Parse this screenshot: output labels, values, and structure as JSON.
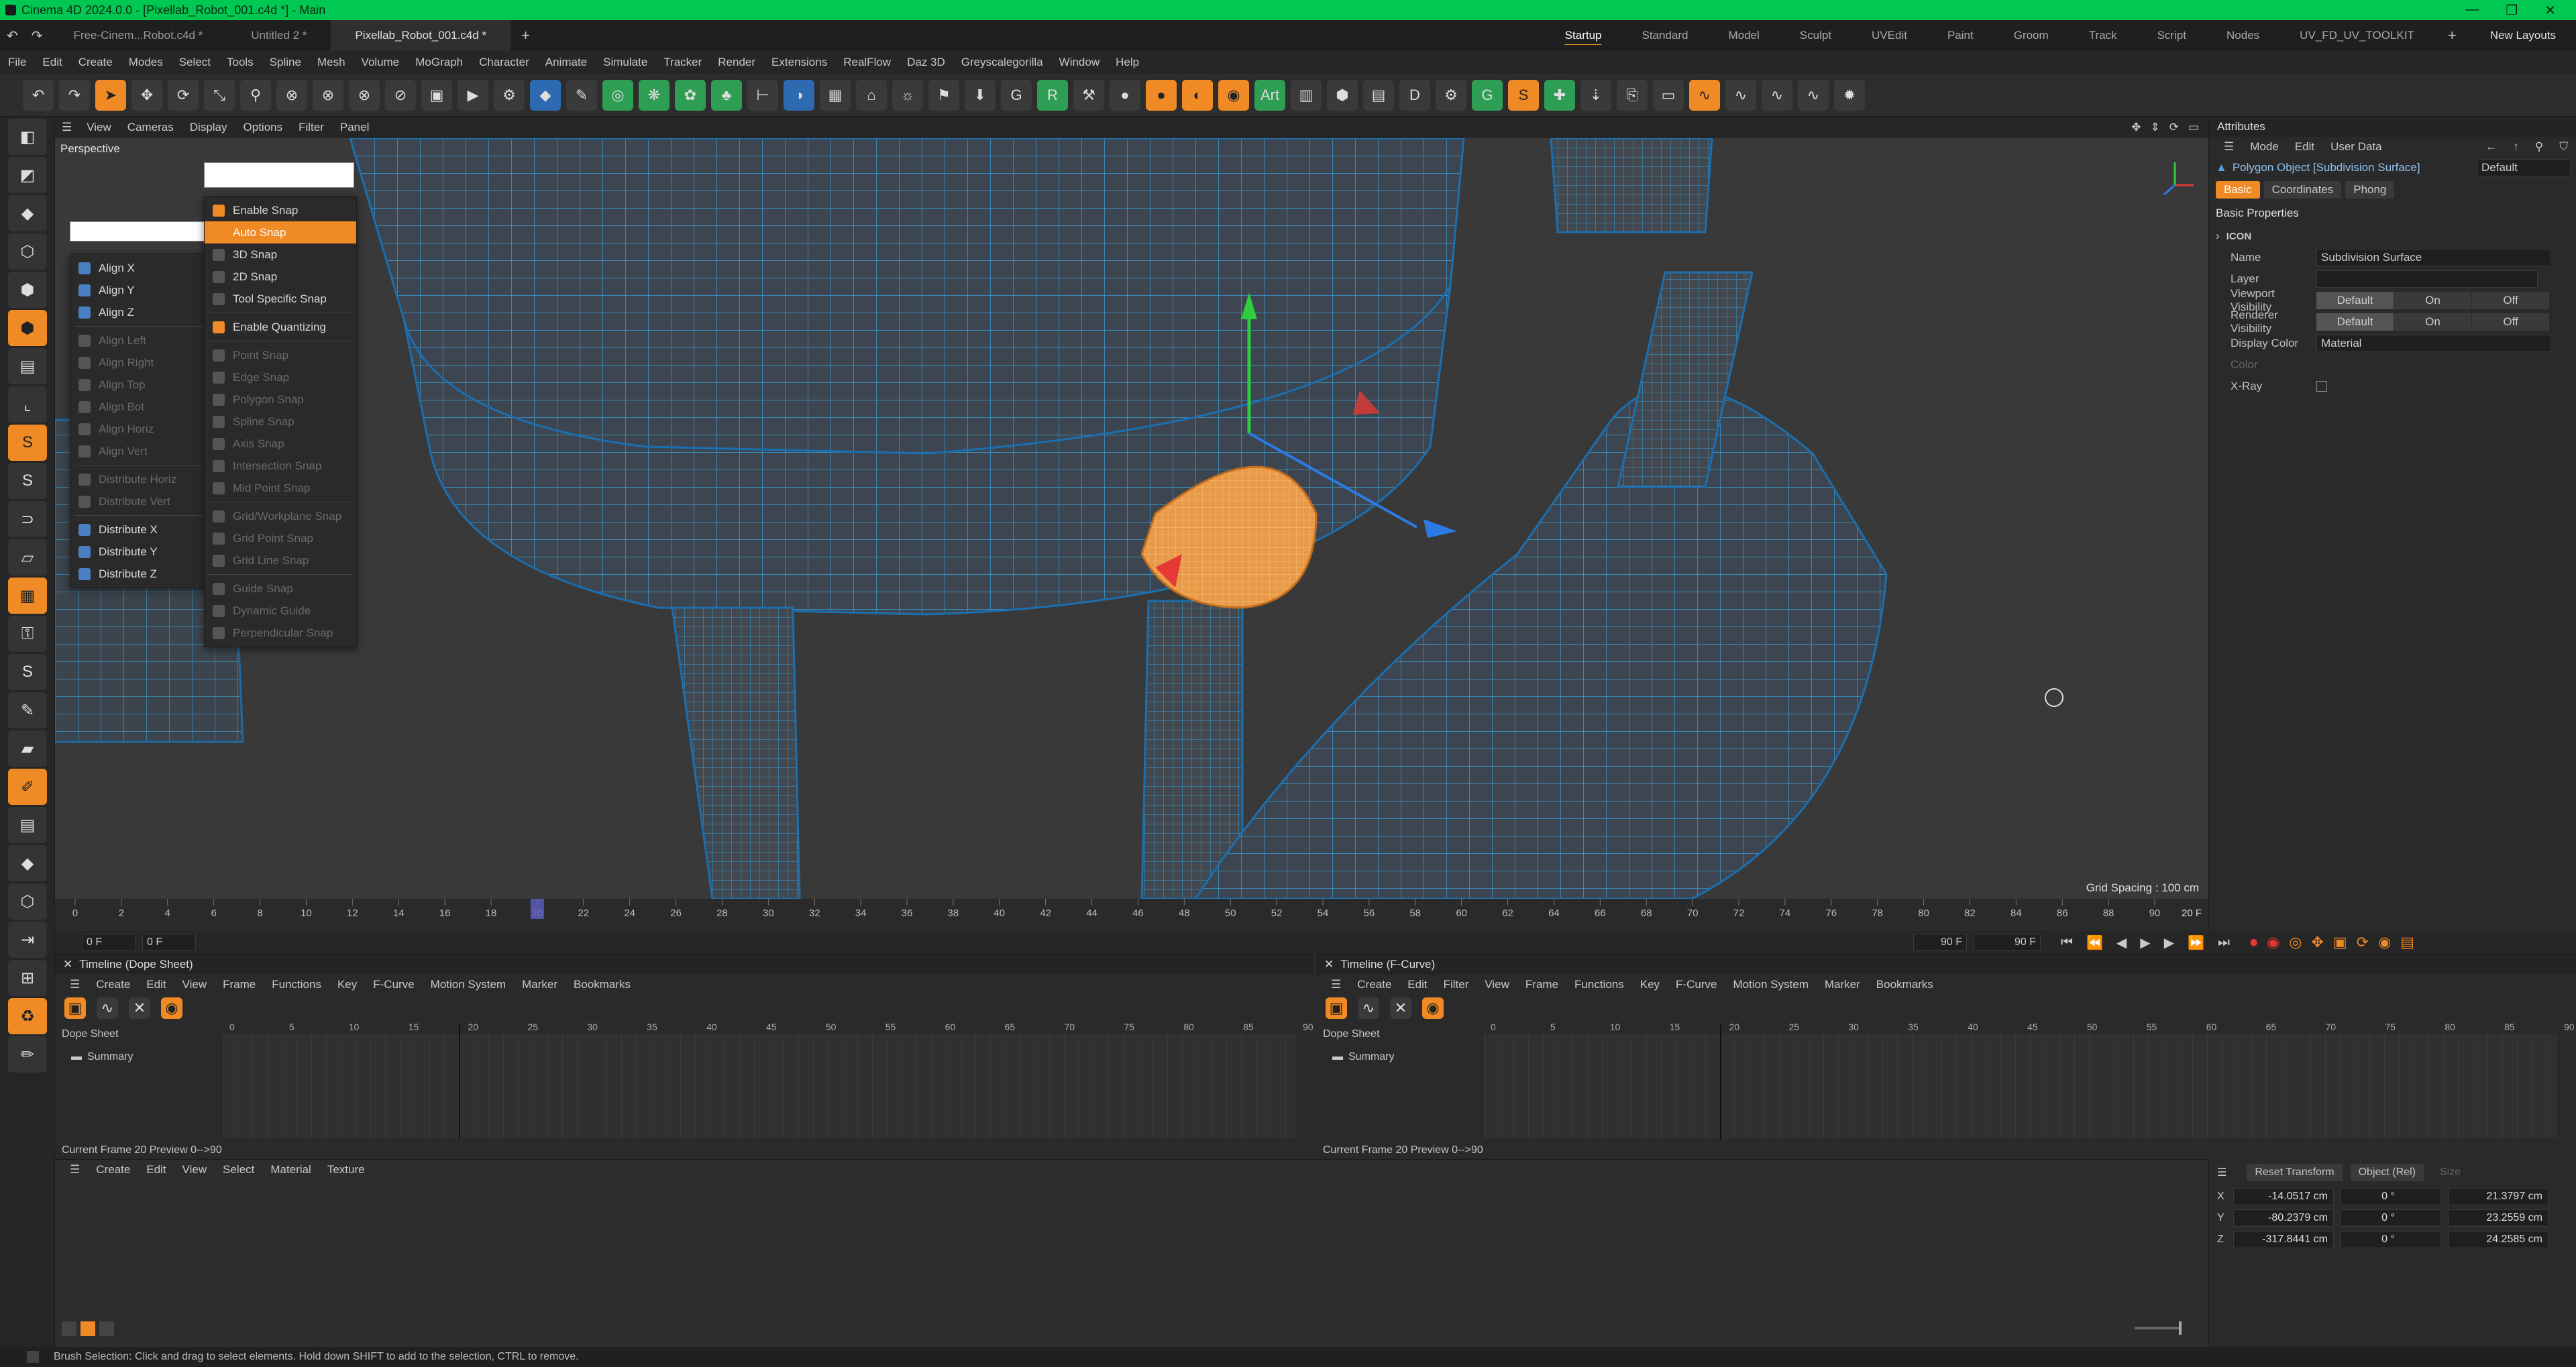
{
  "window": {
    "title": "Cinema 4D 2024.0.0 - [Pixellab_Robot_001.c4d *] - Main"
  },
  "file_tabs": [
    {
      "label": "Free-Cinem...Robot.c4d *",
      "active": false
    },
    {
      "label": "Untitled 2 *",
      "active": false
    },
    {
      "label": "Pixellab_Robot_001.c4d *",
      "active": true
    }
  ],
  "layouts": [
    "Startup",
    "Standard",
    "Model",
    "Sculpt",
    "UVEdit",
    "Paint",
    "Groom",
    "Track",
    "Script",
    "Nodes",
    "UV_FD_UV_TOOLKIT"
  ],
  "new_layouts_label": "New Layouts",
  "menu": [
    "File",
    "Edit",
    "Create",
    "Modes",
    "Select",
    "Tools",
    "Spline",
    "Mesh",
    "Volume",
    "MoGraph",
    "Character",
    "Animate",
    "Simulate",
    "Tracker",
    "Render",
    "Extensions",
    "RealFlow",
    "Daz 3D",
    "Greyscalegorilla",
    "Window",
    "Help"
  ],
  "viewport": {
    "menu": [
      "View",
      "Cameras",
      "Display",
      "Options",
      "Filter",
      "Panel"
    ],
    "camera_label": "Perspective",
    "grid_spacing": "Grid Spacing : 100 cm"
  },
  "align_menu": {
    "items": [
      {
        "label": "Align X",
        "disabled": false
      },
      {
        "label": "Align Y",
        "disabled": false
      },
      {
        "label": "Align Z",
        "disabled": false
      },
      {
        "label": "Align Left",
        "disabled": true
      },
      {
        "label": "Align Right",
        "disabled": true
      },
      {
        "label": "Align Top",
        "disabled": true
      },
      {
        "label": "Align Bot",
        "disabled": true
      },
      {
        "label": "Align Horiz",
        "disabled": true
      },
      {
        "label": "Align Vert",
        "disabled": true
      },
      {
        "label": "Distribute Horiz",
        "disabled": true
      },
      {
        "label": "Distribute Vert",
        "disabled": true
      },
      {
        "label": "Distribute X",
        "disabled": false
      },
      {
        "label": "Distribute Y",
        "disabled": false
      },
      {
        "label": "Distribute Z",
        "disabled": false
      }
    ]
  },
  "snap_menu": {
    "items": [
      {
        "label": "Enable Snap",
        "disabled": false,
        "highlight": false
      },
      {
        "label": "Auto Snap",
        "disabled": false,
        "highlight": true
      },
      {
        "label": "3D Snap",
        "disabled": false,
        "highlight": false
      },
      {
        "label": "2D Snap",
        "disabled": false,
        "highlight": false
      },
      {
        "label": "Tool Specific Snap",
        "disabled": false,
        "highlight": false
      },
      {
        "label": "Enable Quantizing",
        "disabled": false,
        "highlight": false
      },
      {
        "label": "Point Snap",
        "disabled": true,
        "highlight": false
      },
      {
        "label": "Edge Snap",
        "disabled": true,
        "highlight": false
      },
      {
        "label": "Polygon Snap",
        "disabled": true,
        "highlight": false
      },
      {
        "label": "Spline Snap",
        "disabled": true,
        "highlight": false
      },
      {
        "label": "Axis Snap",
        "disabled": true,
        "highlight": false
      },
      {
        "label": "Intersection Snap",
        "disabled": true,
        "highlight": false
      },
      {
        "label": "Mid Point Snap",
        "disabled": true,
        "highlight": false
      },
      {
        "label": "Grid/Workplane Snap",
        "disabled": true,
        "highlight": false
      },
      {
        "label": "Grid Point Snap",
        "disabled": true,
        "highlight": false
      },
      {
        "label": "Grid Line Snap",
        "disabled": true,
        "highlight": false
      },
      {
        "label": "Guide Snap",
        "disabled": true,
        "highlight": false
      },
      {
        "label": "Dynamic Guide",
        "disabled": true,
        "highlight": false
      },
      {
        "label": "Perpendicular Snap",
        "disabled": true,
        "highlight": false
      }
    ]
  },
  "timeline": {
    "ticks": [
      "0",
      "2",
      "4",
      "6",
      "8",
      "10",
      "12",
      "14",
      "16",
      "18",
      "20",
      "22",
      "24",
      "26",
      "28",
      "30",
      "32",
      "34",
      "36",
      "38",
      "40",
      "42",
      "44",
      "46",
      "48",
      "50",
      "52",
      "54",
      "56",
      "58",
      "60",
      "62",
      "64",
      "66",
      "68",
      "70",
      "72",
      "74",
      "76",
      "78",
      "80",
      "82",
      "84",
      "86",
      "88",
      "90"
    ],
    "current_frame_value": 20,
    "end_label": "20 F",
    "start_field": "0 F",
    "start_field2": "0 F",
    "end_field": "90 F",
    "end_field2": "90 F"
  },
  "attributes": {
    "title": "Attributes",
    "menu": [
      "Mode",
      "Edit",
      "User Data"
    ],
    "object_label": "Polygon Object [Subdivision Surface]",
    "preset": "Default",
    "tabs": [
      {
        "label": "Basic",
        "active": true
      },
      {
        "label": "Coordinates",
        "active": false
      },
      {
        "label": "Phong",
        "active": false
      }
    ],
    "section": "Basic Properties",
    "group": "ICON",
    "name_label": "Name",
    "name_value": "Subdivision Surface",
    "layer_label": "Layer",
    "viewport_vis_label": "Viewport Visibility",
    "renderer_vis_label": "Renderer Visibility",
    "vis_options": [
      "Default",
      "On",
      "Off"
    ],
    "display_color_label": "Display Color",
    "display_color_value": "Material",
    "color_label": "Color",
    "xray_label": "X-Ray"
  },
  "dope_sheet": {
    "title": "Timeline (Dope Sheet)",
    "menu": [
      "Create",
      "Edit",
      "View",
      "Frame",
      "Functions",
      "Key",
      "F-Curve",
      "Motion System",
      "Marker",
      "Bookmarks"
    ],
    "ruler": [
      "0",
      "5",
      "10",
      "15",
      "20",
      "25",
      "30",
      "35",
      "40",
      "45",
      "50",
      "55",
      "60",
      "65",
      "70",
      "75",
      "80",
      "85",
      "90"
    ],
    "root": "Dope Sheet",
    "summary": "Summary",
    "footer": "Current Frame  20  Preview  0-->90"
  },
  "fcurve": {
    "title": "Timeline (F-Curve)",
    "menu": [
      "Create",
      "Edit",
      "Filter",
      "View",
      "Frame",
      "Functions",
      "Key",
      "F-Curve",
      "Motion System",
      "Marker",
      "Bookmarks"
    ],
    "ruler": [
      "0",
      "5",
      "10",
      "15",
      "20",
      "25",
      "30",
      "35",
      "40",
      "45",
      "50",
      "55",
      "60",
      "65",
      "70",
      "75",
      "80",
      "85",
      "90"
    ],
    "root": "Dope Sheet",
    "summary": "Summary",
    "footer": "Current Frame  20  Preview  0-->90"
  },
  "material_manager": {
    "menu": [
      "Create",
      "Edit",
      "View",
      "Select",
      "Material",
      "Texture"
    ]
  },
  "coordinates": {
    "reset_label": "Reset Transform",
    "mode": "Object (Rel)",
    "size_label": "Size",
    "rows": [
      {
        "axis": "X",
        "pos": "-14.0517 cm",
        "rot": "0 °",
        "size": "21.3797 cm"
      },
      {
        "axis": "Y",
        "pos": "-80.2379 cm",
        "rot": "0 °",
        "size": "23.2559 cm"
      },
      {
        "axis": "Z",
        "pos": "-317.8441 cm",
        "rot": "0 °",
        "size": "24.2585 cm"
      }
    ]
  },
  "status": "Brush Selection: Click and drag to select elements. Hold down SHIFT to add to the selection, CTRL to remove.",
  "colors": {
    "accent": "#f08a24",
    "titlebar": "#00c853",
    "wire": "#3aa0d8",
    "selection": "#f08a24"
  }
}
